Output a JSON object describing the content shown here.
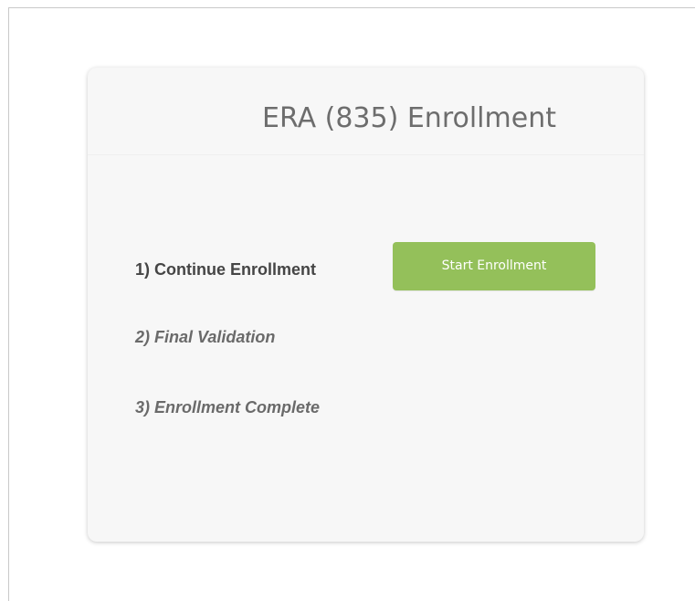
{
  "card": {
    "title": "ERA (835) Enrollment"
  },
  "steps": [
    {
      "label": "1) Continue Enrollment",
      "state": "current"
    },
    {
      "label": "2) Final Validation",
      "state": "pending"
    },
    {
      "label": "3) Enrollment Complete",
      "state": "pending"
    }
  ],
  "actions": {
    "start_label": "Start Enrollment"
  },
  "colors": {
    "button_bg": "#94c05a",
    "card_bg": "#f7f7f7",
    "title_text": "#6d6d6d"
  }
}
